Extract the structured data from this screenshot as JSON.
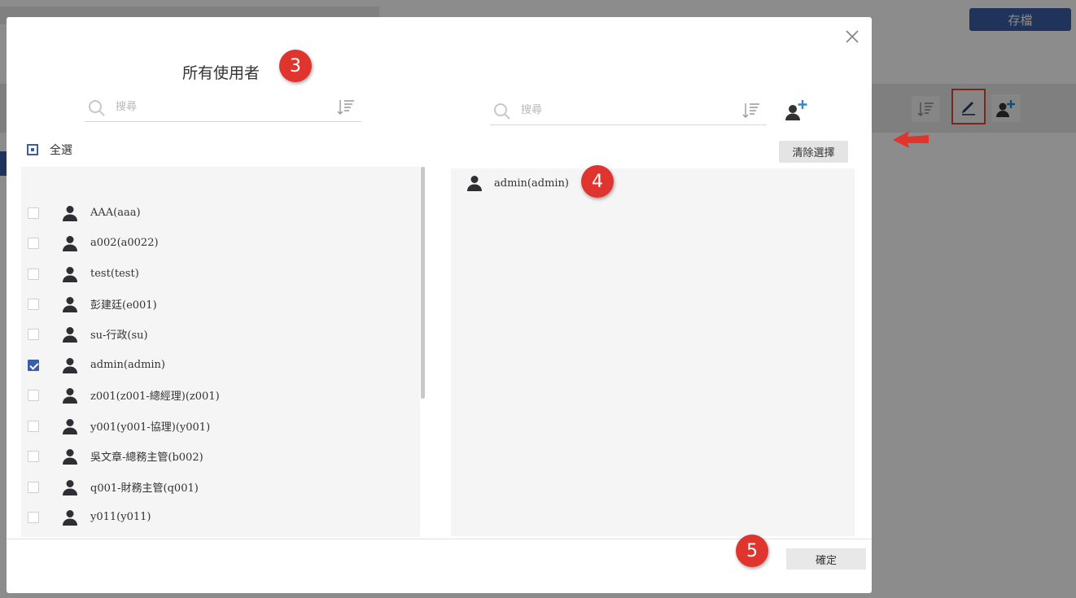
{
  "background": {
    "save_label": "存檔",
    "arrow_color": "#e0342f"
  },
  "modal": {
    "title": "所有使用者",
    "close_icon": "close-icon",
    "left_search_placeholder": "搜尋",
    "right_search_placeholder": "搜尋",
    "select_all_label": "全選",
    "clear_selection_label": "清除選擇",
    "confirm_label": "確定",
    "badges": [
      "3",
      "4",
      "5"
    ],
    "users": [
      {
        "name": "AAA(aaa)",
        "checked": false
      },
      {
        "name": "a002(a0022)",
        "checked": false
      },
      {
        "name": "test(test)",
        "checked": false
      },
      {
        "name": "彭建廷(e001)",
        "checked": false
      },
      {
        "name": "su-行政(su)",
        "checked": false
      },
      {
        "name": "admin(admin)",
        "checked": true
      },
      {
        "name": "z001(z001-總經理)(z001)",
        "checked": false
      },
      {
        "name": "y001(y001-協理)(y001)",
        "checked": false
      },
      {
        "name": "吳文章-總務主管(b002)",
        "checked": false
      },
      {
        "name": "q001-財務主管(q001)",
        "checked": false
      },
      {
        "name": "y011(y011)",
        "checked": false
      }
    ],
    "selected_users": [
      {
        "name": "admin(admin)"
      }
    ]
  },
  "colors": {
    "accent": "#3a5ea7",
    "badge": "#e0342f"
  }
}
